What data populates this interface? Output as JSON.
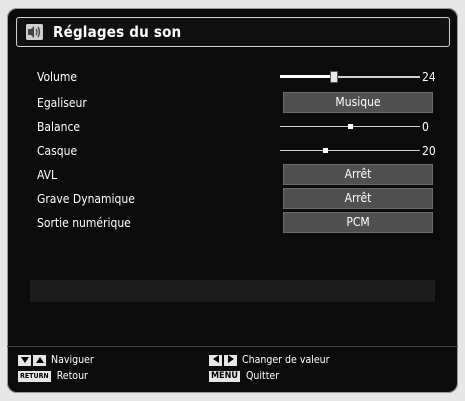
{
  "header": {
    "title": "Réglages du son",
    "icon": "sound-settings-icon"
  },
  "settings": [
    {
      "label": "Volume",
      "kind": "slider",
      "value": "24",
      "level": 0.4
    },
    {
      "label": "Egaliseur",
      "kind": "option",
      "value": "Musique"
    },
    {
      "label": "Balance",
      "kind": "slider",
      "value": "0",
      "level": 0.5
    },
    {
      "label": "Casque",
      "kind": "slider",
      "value": "20",
      "level": 0.32
    },
    {
      "label": "AVL",
      "kind": "option",
      "value": "Arrêt"
    },
    {
      "label": "Grave Dynamique",
      "kind": "option",
      "value": "Arrêt"
    },
    {
      "label": "Sortie numérique",
      "kind": "option",
      "value": "PCM"
    }
  ],
  "footer": {
    "navigate_label": "Naviguer",
    "return_key": "RETURN",
    "return_label": "Retour",
    "change_label": "Changer de valeur",
    "menu_key": "MENU",
    "quit_label": "Quitter"
  },
  "colors": {
    "background": "#0b0b0b",
    "option_bg": "#505050",
    "text": "#ffffff"
  }
}
